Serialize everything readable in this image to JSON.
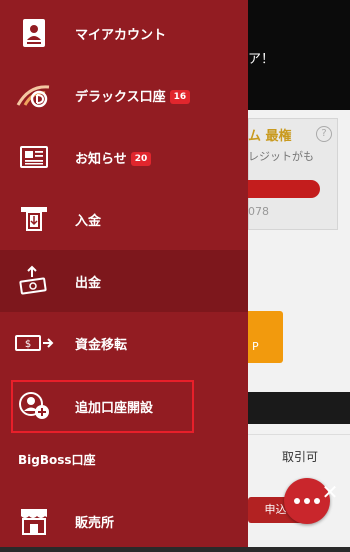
{
  "menu": {
    "items": [
      {
        "label": "マイアカウント",
        "icon": "account-card-icon"
      },
      {
        "label": "デラックス口座",
        "badge": "16",
        "icon": "deluxe-logo-icon"
      },
      {
        "label": "お知らせ",
        "badge": "20",
        "icon": "newspaper-icon"
      },
      {
        "label": "入金",
        "icon": "deposit-atm-icon"
      },
      {
        "label": "出金",
        "icon": "withdraw-cash-icon"
      },
      {
        "label": "資金移転",
        "icon": "transfer-money-icon"
      },
      {
        "label": "追加口座開設",
        "icon": "add-user-icon"
      },
      {
        "label": "販売所",
        "icon": "shop-icon"
      }
    ],
    "section_label": "BigBoss口座"
  },
  "background_page": {
    "banner_text": "ア！",
    "promo_text": "ム 最権",
    "promo_sub": "レジットがも",
    "number_text": "078",
    "help_icon": "?",
    "orange_text": "P",
    "row_text": "取引可",
    "apply_button": "申込"
  },
  "colors": {
    "drawer": "#921c22",
    "drawer_active": "#7d171c",
    "badge": "#e1262d",
    "highlight": "#e81f2a"
  }
}
